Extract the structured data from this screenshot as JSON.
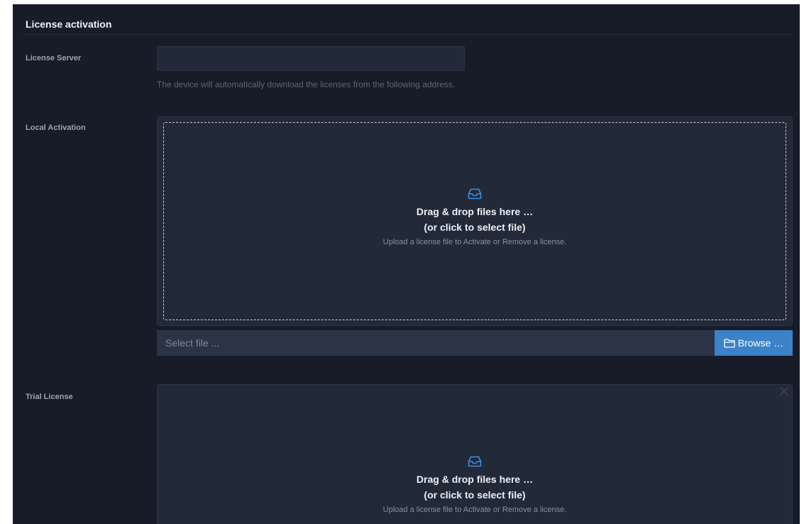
{
  "section": {
    "title": "License activation"
  },
  "license_server": {
    "label": "License Server",
    "value": "",
    "help": "The device will automatically download the licenses from the following address."
  },
  "local_activation": {
    "label": "Local Activation",
    "dropzone": {
      "title": "Drag & drop files here …",
      "subtitle": "(or click to select file)",
      "hint": "Upload a license file to Activate or Remove a license.",
      "icon": "tray-icon"
    },
    "file_input": {
      "placeholder": "Select file ..."
    },
    "browse_button": {
      "label": "Browse …",
      "icon": "folder-icon"
    }
  },
  "trial_license": {
    "label": "Trial License",
    "close_icon": "close-icon",
    "dropzone": {
      "title": "Drag & drop files here …",
      "subtitle": "(or click to select file)",
      "hint": "Upload a license file to Activate or Remove a license.",
      "icon": "tray-icon"
    }
  },
  "colors": {
    "background": "#171c28",
    "panel": "#222938",
    "accent": "#3b82c9",
    "icon_blue": "#3d8fe6"
  }
}
